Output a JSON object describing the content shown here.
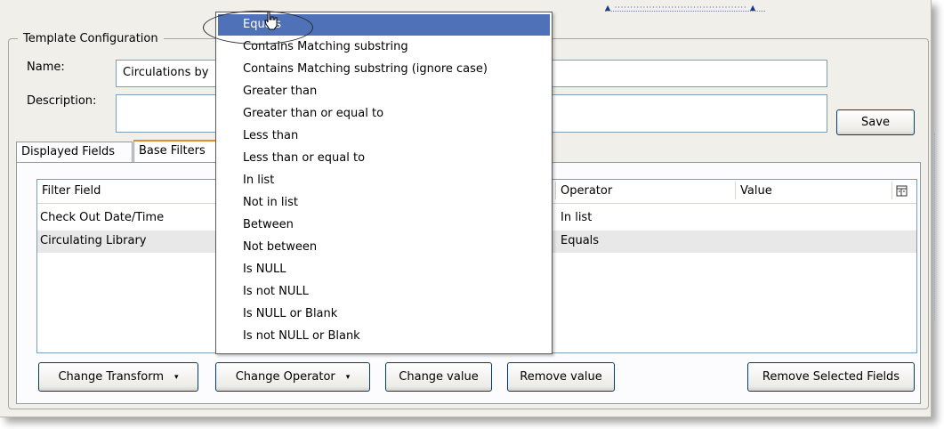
{
  "template_config": {
    "legend": "Template Configuration",
    "name_label": "Name:",
    "name_value": "Circulations by",
    "description_label": "Description:",
    "description_value": "",
    "save_label": "Save"
  },
  "tabs": [
    {
      "label": "Displayed Fields"
    },
    {
      "label": "Base Filters"
    }
  ],
  "grid": {
    "columns": [
      "Filter Field",
      "Operator",
      "Value"
    ],
    "rows": [
      {
        "field": "Check Out Date/Time",
        "operator": "In list",
        "value": ""
      },
      {
        "field": "Circulating Library",
        "operator": "Equals",
        "value": ""
      }
    ],
    "column_picker_icon": "column-picker-icon"
  },
  "buttons": {
    "change_transform": "Change Transform",
    "change_operator": "Change Operator",
    "change_value": "Change value",
    "remove_value": "Remove value",
    "remove_selected_fields": "Remove Selected Fields",
    "dropdown_caret": "▾"
  },
  "operator_menu": {
    "selected": "Equals",
    "items": [
      "Equals",
      "Contains Matching substring",
      "Contains Matching substring (ignore case)",
      "Greater than",
      "Greater than or equal to",
      "Less than",
      "Less than or equal to",
      "In list",
      "Not in list",
      "Between",
      "Not between",
      "Is NULL",
      "Is not NULL",
      "Is NULL or Blank",
      "Is not NULL or Blank"
    ]
  },
  "colors": {
    "highlight": "#4f71b7",
    "active_tab_accent": "#e68b2c",
    "button_border": "#003c74"
  }
}
